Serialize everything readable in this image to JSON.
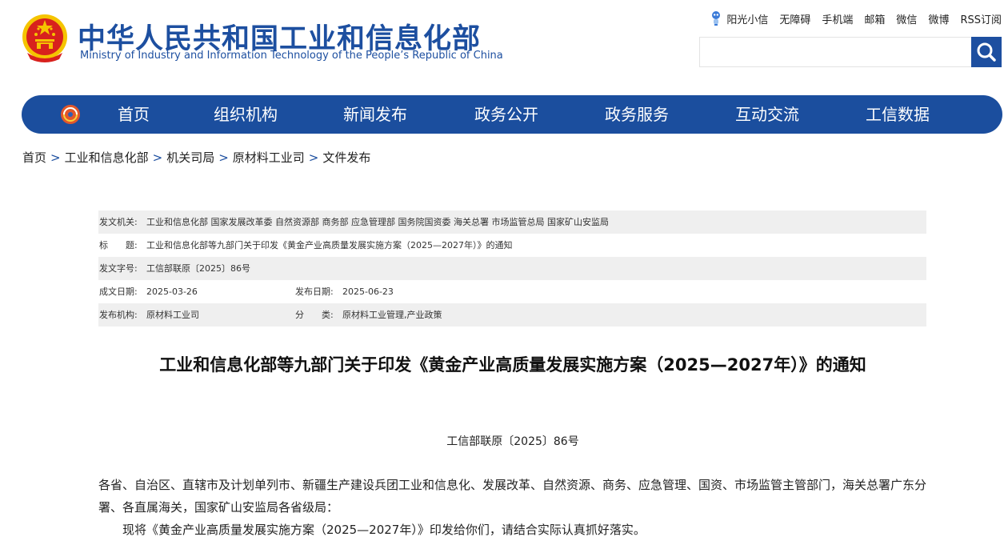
{
  "header": {
    "title_cn": "中华人民共和国工业和信息化部",
    "title_en": "Ministry of Industry and Information Technology of the People’s Republic of China",
    "top_links": [
      "阳光小信",
      "无障碍",
      "手机端",
      "邮箱",
      "微信",
      "微博",
      "RSS订阅"
    ],
    "search_placeholder": ""
  },
  "nav": {
    "items": [
      "首页",
      "组织机构",
      "新闻发布",
      "政务公开",
      "政务服务",
      "互动交流",
      "工信数据"
    ]
  },
  "breadcrumb": [
    "首页",
    "工业和信息化部",
    "机关司局",
    "原材料工业司",
    "文件发布"
  ],
  "meta": {
    "issuer_label": "发文机关:",
    "issuer": "工业和信息化部 国家发展改革委 自然资源部 商务部 应急管理部 国务院国资委 海关总署 市场监管总局 国家矿山安监局",
    "title_label": "标　　题:",
    "title": "工业和信息化部等九部门关于印发《黄金产业高质量发展实施方案（2025—2027年）》的通知",
    "docno_label": "发文字号:",
    "docno": "工信部联原〔2025〕86号",
    "created_label": "成文日期:",
    "created": "2025-03-26",
    "published_label": "发布日期:",
    "published": "2025-06-23",
    "org_label": "发布机构:",
    "org": "原材料工业司",
    "category_label": "分　　类:",
    "category": "原材料工业管理,产业政策"
  },
  "document": {
    "title": "工业和信息化部等九部门关于印发《黄金产业高质量发展实施方案（2025—2027年）》的通知",
    "number": "工信部联原〔2025〕86号",
    "para1": "各省、自治区、直辖市及计划单列市、新疆生产建设兵团工业和信息化、发展改革、自然资源、商务、应急管理、国资、市场监管主管部门，海关总署广东分署、各直属海关，国家矿山安监局各省级局：",
    "para2": "现将《黄金产业高质量发展实施方案（2025—2027年）》印发给你们，请结合实际认真抓好落实。"
  },
  "colors": {
    "brand_blue": "#1b4e9e",
    "meta_shade": "#efefef",
    "emblem_red": "#d8211d",
    "emblem_gold": "#f5c400"
  }
}
